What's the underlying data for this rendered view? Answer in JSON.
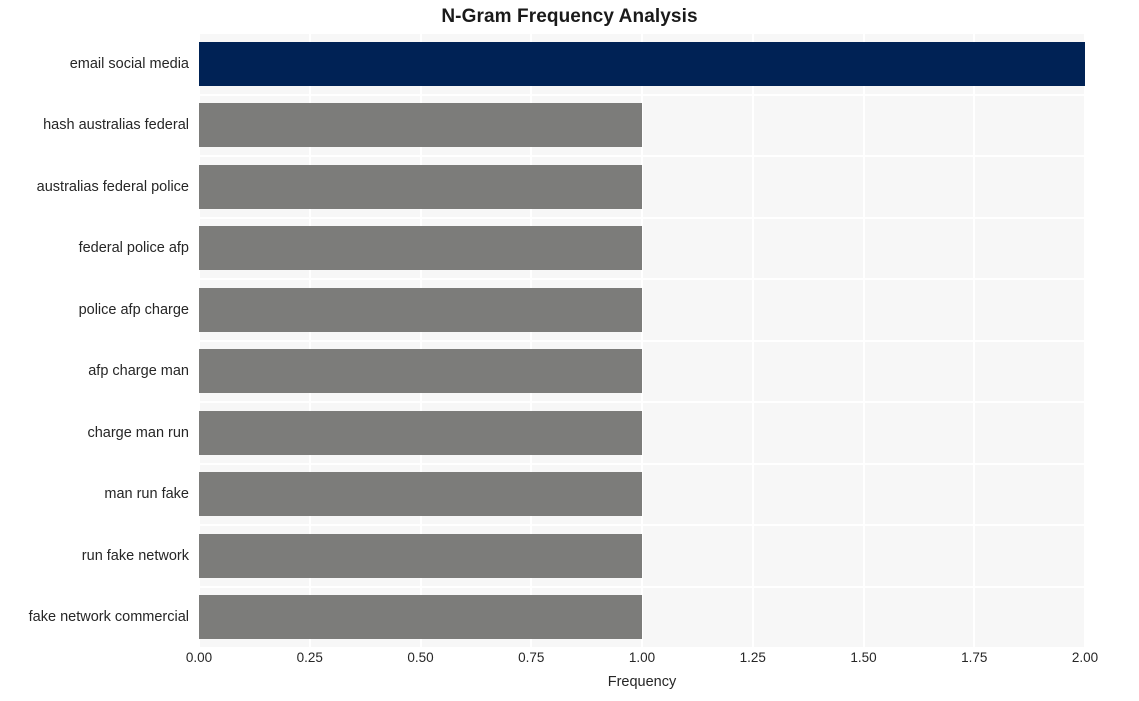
{
  "chart_data": {
    "type": "bar",
    "orientation": "horizontal",
    "title": "N-Gram Frequency Analysis",
    "xlabel": "Frequency",
    "ylabel": "",
    "categories": [
      "email social media",
      "hash australias federal",
      "australias federal police",
      "federal police afp",
      "police afp charge",
      "afp charge man",
      "charge man run",
      "man run fake",
      "run fake network",
      "fake network commercial"
    ],
    "values": [
      2,
      1,
      1,
      1,
      1,
      1,
      1,
      1,
      1,
      1
    ],
    "xlim": [
      0,
      2
    ],
    "xticks": [
      "0.00",
      "0.25",
      "0.50",
      "0.75",
      "1.00",
      "1.25",
      "1.50",
      "1.75",
      "2.00"
    ],
    "xtick_values": [
      0,
      0.25,
      0.5,
      0.75,
      1,
      1.25,
      1.5,
      1.75,
      2
    ],
    "bar_colors": [
      "#002255",
      "#7c7c7a",
      "#7c7c7a",
      "#7c7c7a",
      "#7c7c7a",
      "#7c7c7a",
      "#7c7c7a",
      "#7c7c7a",
      "#7c7c7a",
      "#7c7c7a"
    ],
    "highlight_color": "#002255",
    "default_color": "#7c7c7a",
    "plot_background": "#f7f7f7",
    "grid_color": "#ffffff",
    "grid": true,
    "legend": "none"
  }
}
